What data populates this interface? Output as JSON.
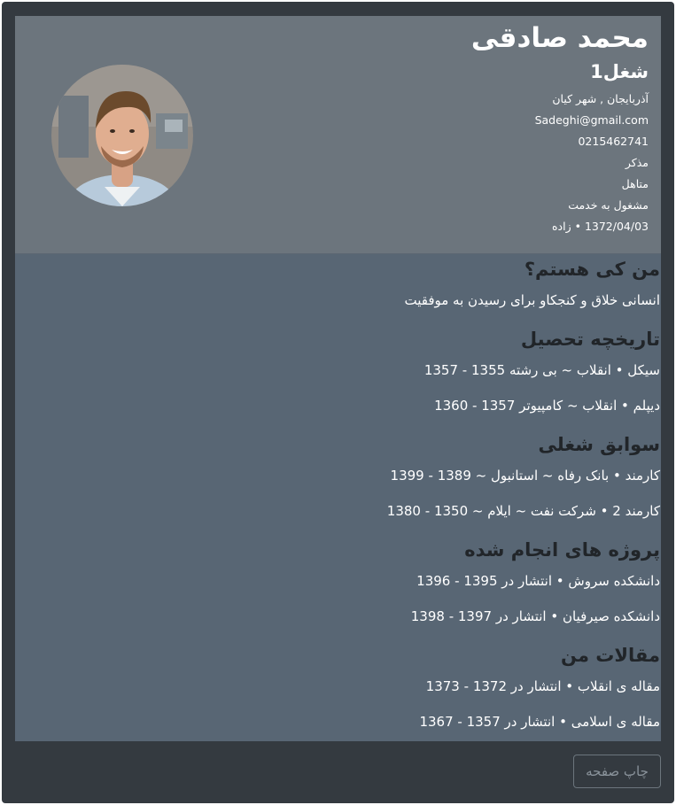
{
  "profile": {
    "name": "محمد صادقی",
    "job": "شغل1",
    "location": "آذربایجان , شهر کیان",
    "email": "Sadeghi@gmail.com",
    "phone": "0215462741",
    "gender": "مذکر",
    "marital": "متاهل",
    "military": "مشغول به خدمت",
    "birth": "1372/04/03 • زاده"
  },
  "about": {
    "title": "من کی هستم؟",
    "text": "انسانی خلاق و کنجکاو برای رسیدن به موفقیت"
  },
  "education": {
    "title": "تاریخچه تحصیل",
    "items": [
      "سیکل • انقلاب ~ بی رشته 1355 - 1357",
      "دیپلم • انقلاب ~ کامپیوتر 1357 - 1360"
    ]
  },
  "jobs": {
    "title": "سوابق شغلی",
    "items": [
      "کارمند • بانک رفاه ~ استانبول ~ 1389 - 1399",
      "کارمند 2 • شرکت نفت ~ ایلام ~ 1350 - 1380"
    ]
  },
  "projects": {
    "title": "پروژه های انجام شده",
    "items": [
      "دانشکده سروش • انتشار در 1395 - 1396",
      "دانشکده صیرفیان • انتشار در 1397 - 1398"
    ]
  },
  "articles": {
    "title": "مقالات من",
    "items": [
      "مقاله ی انقلاب • انتشار در 1372 - 1373",
      "مقاله ی اسلامی • انتشار در 1357 - 1367"
    ]
  },
  "footer": {
    "print_label": "چاپ صفحه"
  }
}
